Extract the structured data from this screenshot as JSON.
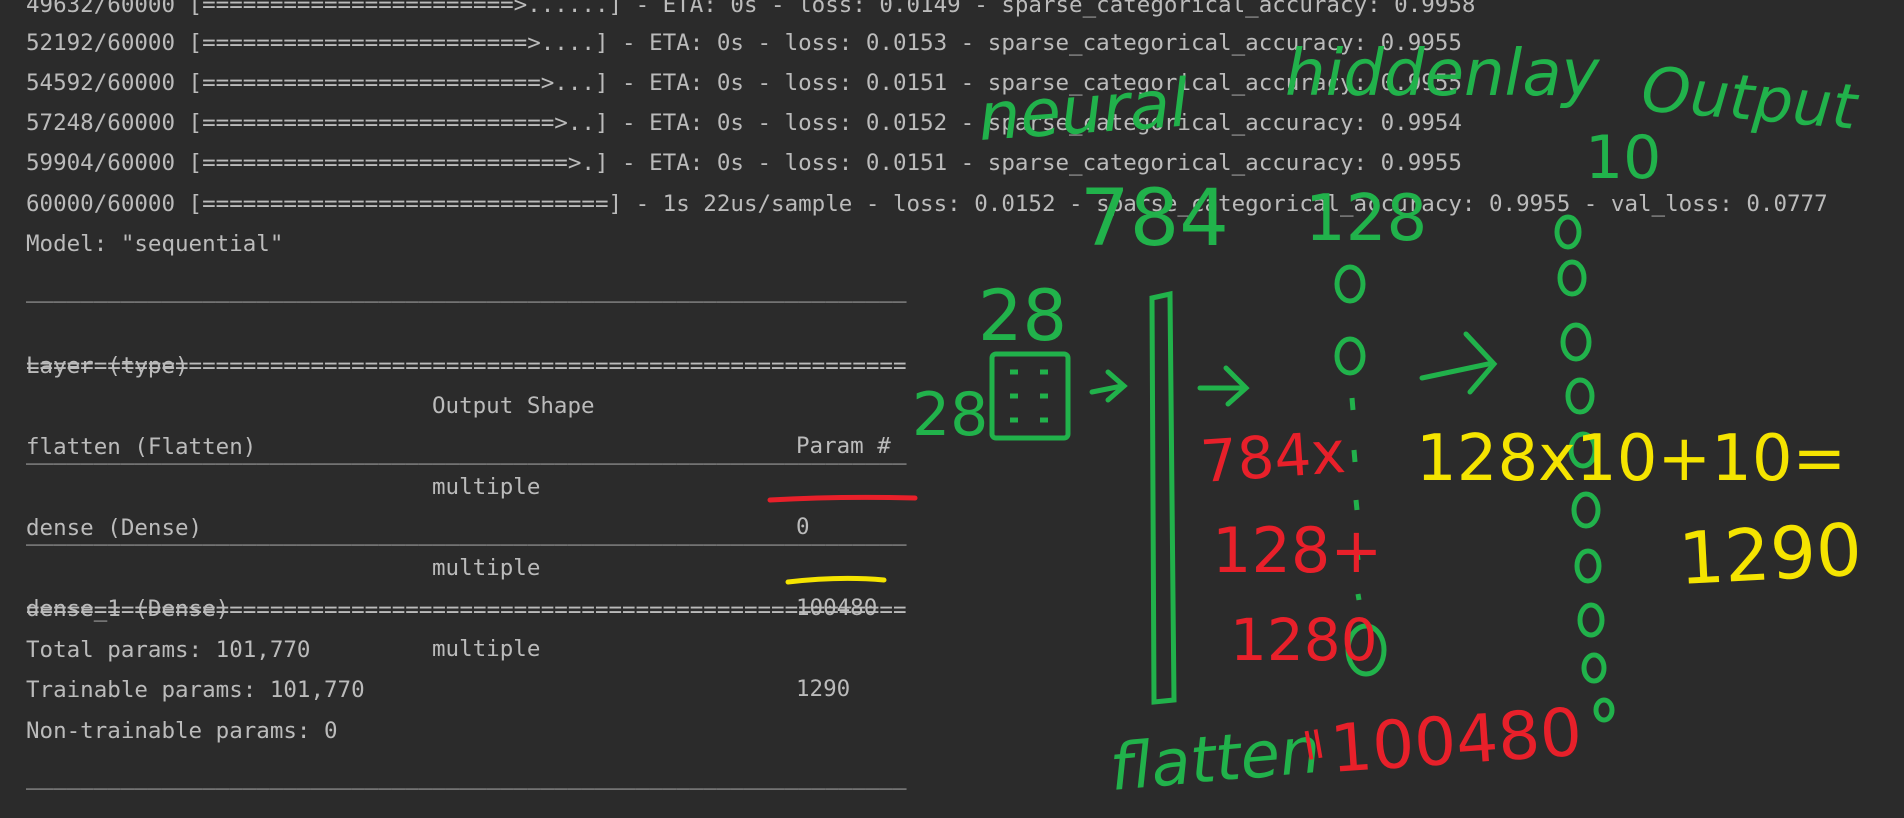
{
  "console": {
    "progress_lines": [
      "49632/60000 [=======================>......] - ETA: 0s - loss: 0.0149 - sparse_categorical_accuracy: 0.9958",
      "52192/60000 [========================>....] - ETA: 0s - loss: 0.0153 - sparse_categorical_accuracy: 0.9955",
      "54592/60000 [=========================>...] - ETA: 0s - loss: 0.0151 - sparse_categorical_accuracy: 0.9955",
      "57248/60000 [==========================>..] - ETA: 0s - loss: 0.0152 - sparse_categorical_accuracy: 0.9954",
      "59904/60000 [===========================>.] - ETA: 0s - loss: 0.0151 - sparse_categorical_accuracy: 0.9955",
      "60000/60000 [==============================] - 1s 22us/sample - loss: 0.0152 - sparse_categorical_accuracy: 0.9955 - val_loss: 0.0777"
    ],
    "model_title": "Model: \"sequential\"",
    "separator_dash": "_________________________________________________________________",
    "separator_eq": "=================================================================",
    "header": {
      "layer": "Layer (type)",
      "shape": "Output Shape",
      "params": "Param #"
    },
    "rows": [
      {
        "layer": "flatten (Flatten)",
        "shape": "multiple",
        "params": "0"
      },
      {
        "layer": "dense (Dense)",
        "shape": "multiple",
        "params": "100480"
      },
      {
        "layer": "dense_1 (Dense)",
        "shape": "multiple",
        "params": "1290"
      }
    ],
    "totals": [
      "Total params: 101,770",
      "Trainable params: 101,770",
      "Non-trainable params: 0"
    ]
  },
  "annotations": {
    "colors": {
      "green": "#21b24b",
      "red": "#e8202a",
      "yellow": "#f5e400"
    },
    "neural": "neural",
    "hidden": "hiddenlay",
    "output": "Output",
    "n784": "784",
    "n128": "128",
    "n10": "10",
    "grid28_top": "28",
    "grid28_left": "28",
    "flatten": "flatten",
    "red_line1": "784x",
    "red_line2": "128+",
    "red_line3": "1280",
    "red_eq": "=",
    "red_result": "100480",
    "yellow_formula": "128x10+10=",
    "yellow_result": "1290"
  }
}
